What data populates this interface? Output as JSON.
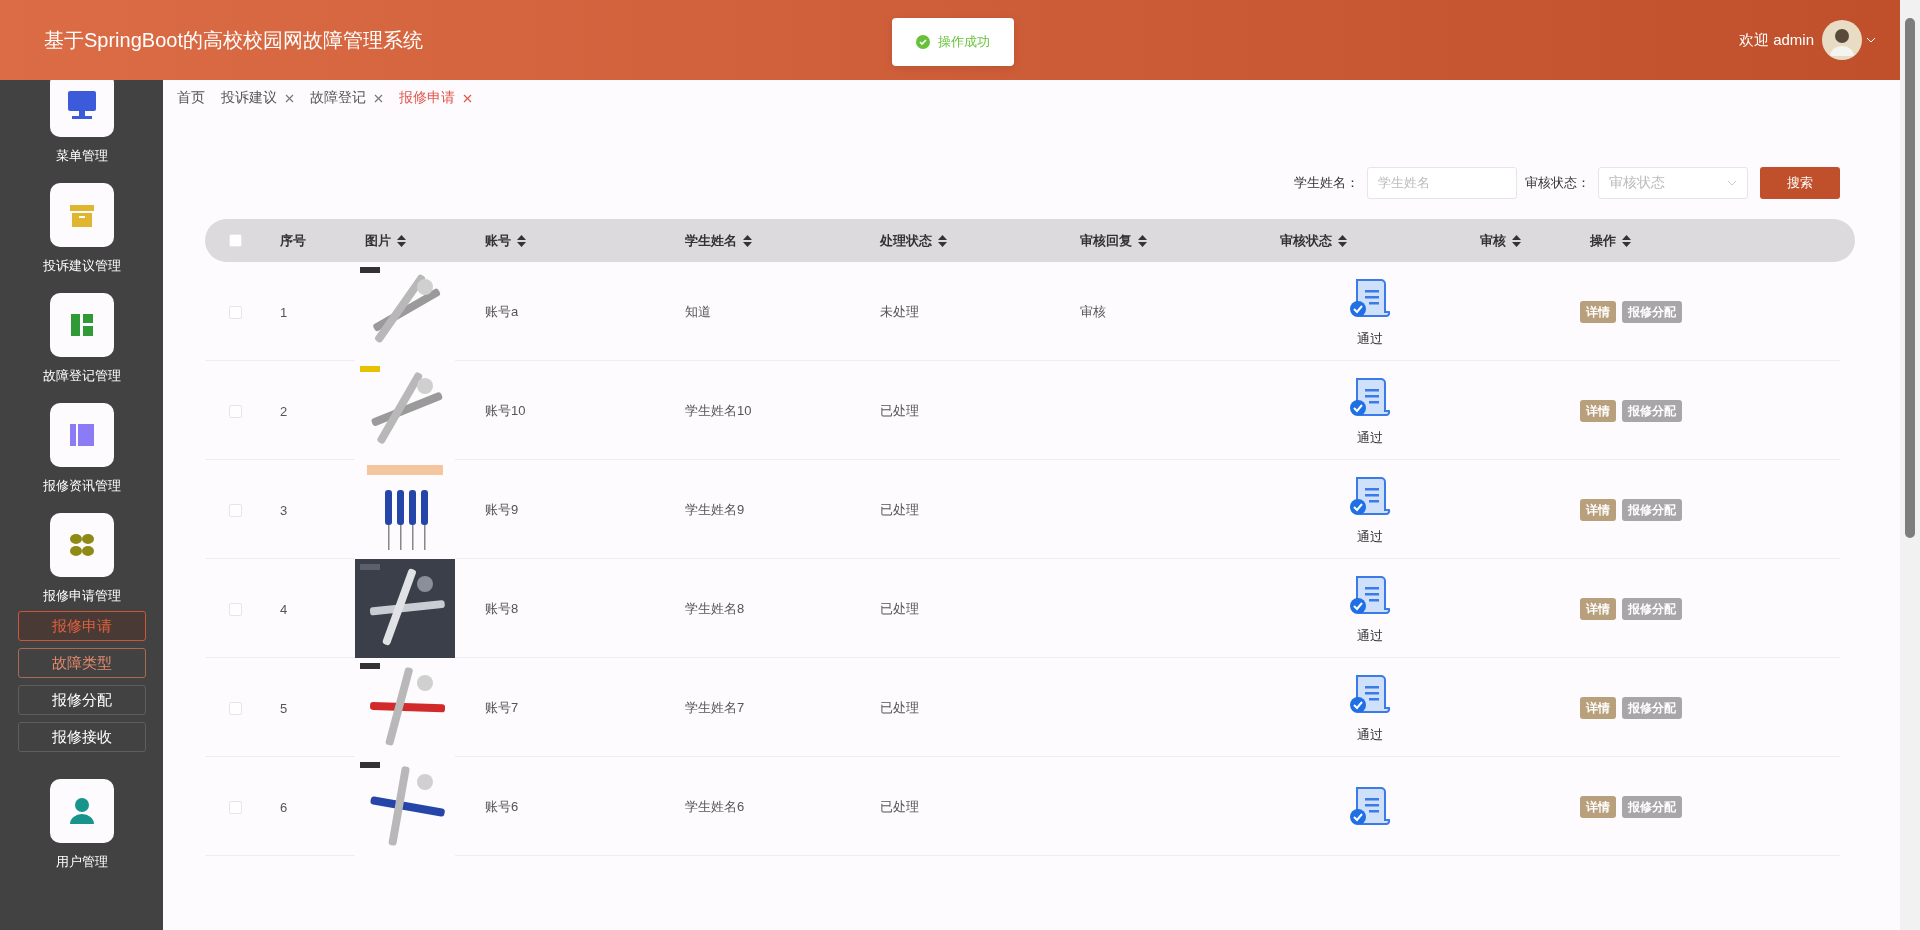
{
  "header": {
    "title": "基于SpringBoot的高校校园网故障管理系统",
    "welcome": "欢迎 admin"
  },
  "toast": {
    "message": "操作成功"
  },
  "sidebar": {
    "items": [
      {
        "label": "菜单管理"
      },
      {
        "label": "投诉建议管理"
      },
      {
        "label": "故障登记管理"
      },
      {
        "label": "报修资讯管理"
      },
      {
        "label": "报修申请管理",
        "children": [
          {
            "label": "报修申请",
            "selected": true,
            "hovered": false
          },
          {
            "label": "故障类型",
            "selected": false,
            "hovered": true
          },
          {
            "label": "报修分配",
            "selected": false,
            "hovered": false
          },
          {
            "label": "报修接收",
            "selected": false,
            "hovered": false
          }
        ]
      },
      {
        "label": "用户管理"
      }
    ]
  },
  "tabs": [
    {
      "label": "首页",
      "selected": false,
      "closable": false
    },
    {
      "label": "投诉建议",
      "selected": false,
      "closable": true
    },
    {
      "label": "故障登记",
      "selected": false,
      "closable": true
    },
    {
      "label": "报修申请",
      "selected": true,
      "closable": true
    }
  ],
  "search": {
    "fields": [
      {
        "kind": "input",
        "label": "学生姓名：",
        "placeholder": "学生姓名"
      },
      {
        "kind": "select",
        "label": "审核状态：",
        "placeholder": "审核状态"
      }
    ],
    "button": "搜索"
  },
  "table": {
    "columns": [
      {
        "label": "序号",
        "sortable": false
      },
      {
        "label": "图片",
        "sortable": true
      },
      {
        "label": "账号",
        "sortable": true
      },
      {
        "label": "学生姓名",
        "sortable": true
      },
      {
        "label": "处理状态",
        "sortable": true
      },
      {
        "label": "审核回复",
        "sortable": true
      },
      {
        "label": "审核状态",
        "sortable": true
      },
      {
        "label": "审核",
        "sortable": true
      },
      {
        "label": "操作",
        "sortable": true
      }
    ],
    "all_checked": false,
    "rows": [
      {
        "checked": false,
        "index": "1",
        "account": "账号a",
        "student": "知道",
        "status": "未处理",
        "reply": "审核",
        "audit": "通过",
        "actions": [
          "详情",
          "报修分配"
        ]
      },
      {
        "checked": false,
        "index": "2",
        "account": "账号10",
        "student": "学生姓名10",
        "status": "已处理",
        "audit": "通过",
        "actions": [
          "详情",
          "报修分配"
        ]
      },
      {
        "checked": false,
        "index": "3",
        "account": "账号9",
        "student": "学生姓名9",
        "status": "已处理",
        "audit": "通过",
        "actions": [
          "详情",
          "报修分配"
        ]
      },
      {
        "checked": false,
        "index": "4",
        "account": "账号8",
        "student": "学生姓名8",
        "status": "已处理",
        "audit": "通过",
        "actions": [
          "详情",
          "报修分配"
        ]
      },
      {
        "checked": false,
        "index": "5",
        "account": "账号7",
        "student": "学生姓名7",
        "status": "已处理",
        "audit": "通过",
        "actions": [
          "详情",
          "报修分配"
        ]
      },
      {
        "checked": false,
        "index": "6",
        "account": "账号6",
        "student": "学生姓名6",
        "status": "已处理",
        "actions": [
          "详情",
          "报修分配"
        ]
      }
    ]
  }
}
